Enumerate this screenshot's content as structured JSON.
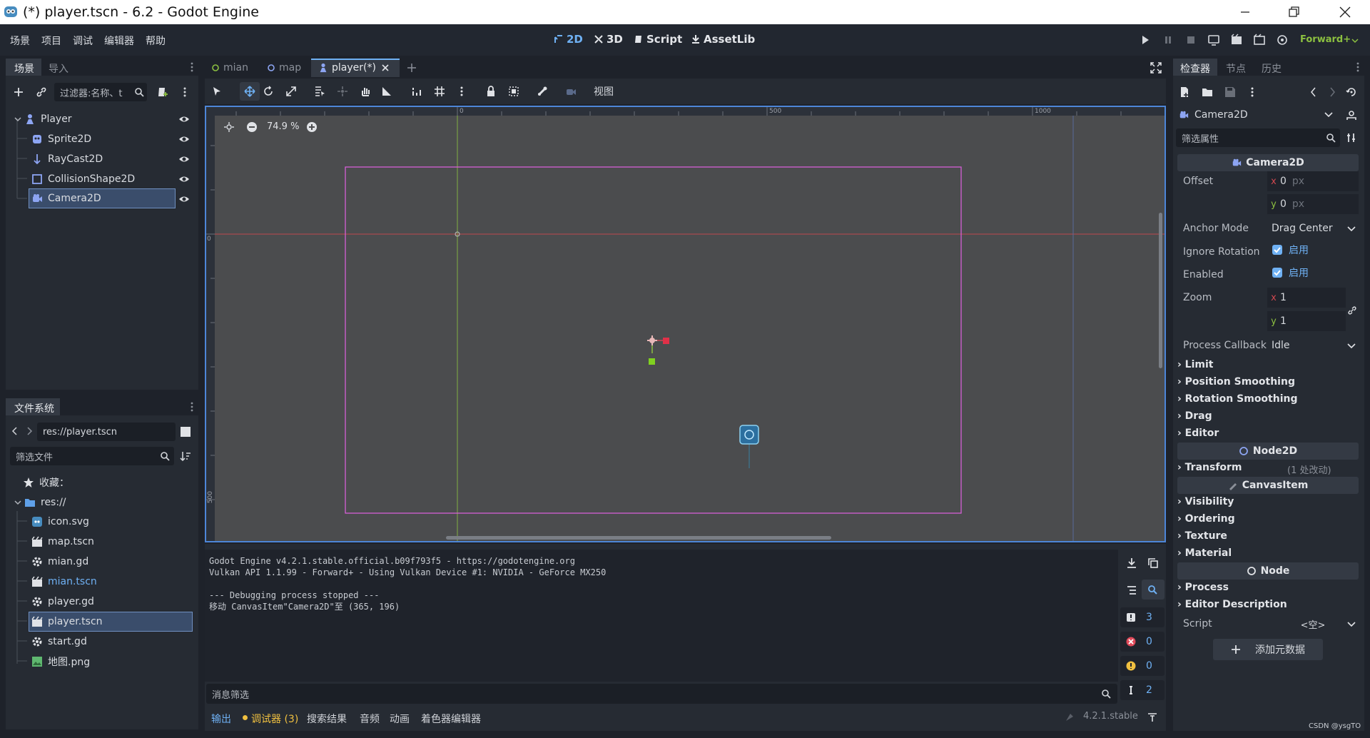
{
  "window": {
    "title": "(*) player.tscn - 6.2 - Godot Engine"
  },
  "menu": [
    "场景",
    "项目",
    "调试",
    "编辑器",
    "帮助"
  ],
  "workspaces": [
    {
      "label": "2D",
      "active": true
    },
    {
      "label": "3D",
      "active": false
    },
    {
      "label": "Script",
      "active": false
    },
    {
      "label": "AssetLib",
      "active": false
    }
  ],
  "renderer": "Forward+",
  "scene_dock": {
    "tabs": [
      "场景",
      "导入"
    ],
    "filter_placeholder": "过滤器:名称、t",
    "nodes": [
      {
        "name": "Player",
        "icon": "player-icon"
      },
      {
        "name": "Sprite2D",
        "icon": "sprite-icon"
      },
      {
        "name": "RayCast2D",
        "icon": "raycast-icon"
      },
      {
        "name": "CollisionShape2D",
        "icon": "collision-icon"
      },
      {
        "name": "Camera2D",
        "icon": "camera-icon"
      }
    ]
  },
  "filesystem": {
    "tab": "文件系统",
    "path": "res://player.tscn",
    "filter_placeholder": "筛选文件",
    "favorites": "收藏：",
    "root": "res://",
    "files": [
      "icon.svg",
      "map.tscn",
      "mian.gd",
      "mian.tscn",
      "player.gd",
      "player.tscn",
      "start.gd",
      "地图.png"
    ]
  },
  "editor_tabs": [
    {
      "label": "mian"
    },
    {
      "label": "map"
    },
    {
      "label": "player(*)"
    }
  ],
  "toolbar": {
    "view_label": "视图",
    "zoom": "74.9 %"
  },
  "ruler": {
    "h": [
      "0",
      "500",
      "1000"
    ],
    "v": [
      "0",
      "500"
    ]
  },
  "inspector": {
    "tabs": [
      "检查器",
      "节点",
      "历史"
    ],
    "object": "Camera2D",
    "filter_placeholder": "筛选属性",
    "class_header": "Camera2D",
    "props": {
      "offset_label": "Offset",
      "offset_x": "0",
      "offset_y": "0",
      "unit": "px",
      "anchor_label": "Anchor Mode",
      "anchor_value": "Drag Center",
      "ignore_rotation_label": "Ignore Rotation",
      "enabled_label": "Enabled",
      "on_text": "启用",
      "zoom_label": "Zoom",
      "zoom_x": "1",
      "zoom_y": "1",
      "process_callback_label": "Process Callback",
      "process_callback_value": "Idle"
    },
    "sections_camera": [
      "Limit",
      "Position Smoothing",
      "Rotation Smoothing",
      "Drag",
      "Editor"
    ],
    "node2d_header": "Node2D",
    "transform": "Transform",
    "transform_changed": "(1 处改动)",
    "canvas_header": "CanvasItem",
    "sections_canvas": [
      "Visibility",
      "Ordering",
      "Texture",
      "Material"
    ],
    "node_header": "Node",
    "sections_node": [
      "Process",
      "Editor Description"
    ],
    "script_label": "Script",
    "script_value": "<空>",
    "add_metadata": "添加元数据"
  },
  "console": {
    "lines": [
      "Godot Engine v4.2.1.stable.official.b09f793f5 - https://godotengine.org",
      "Vulkan API 1.1.99 - Forward+ - Using Vulkan Device #1: NVIDIA - GeForce MX250",
      "",
      "--- Debugging process stopped ---",
      "移动 CanvasItem\"Camera2D\"至 (365, 196)"
    ],
    "filter_placeholder": "消息筛选",
    "counts": {
      "messages": "3",
      "errors": "0",
      "warnings": "0",
      "info": "2"
    }
  },
  "bottom_tabs": [
    "输出",
    "调试器 (3)",
    "搜索结果",
    "音频",
    "动画",
    "着色器编辑器"
  ],
  "version": "4.2.1.stable",
  "watermark": "CSDN @ysgTO",
  "colors": {
    "accent": "#6fb1f4",
    "selection": "#3a4d6b",
    "viewport_border": "#4d86d8",
    "camera_rect": "#e060e0",
    "x_axis": "#d04850",
    "y_axis": "#8cc040"
  }
}
